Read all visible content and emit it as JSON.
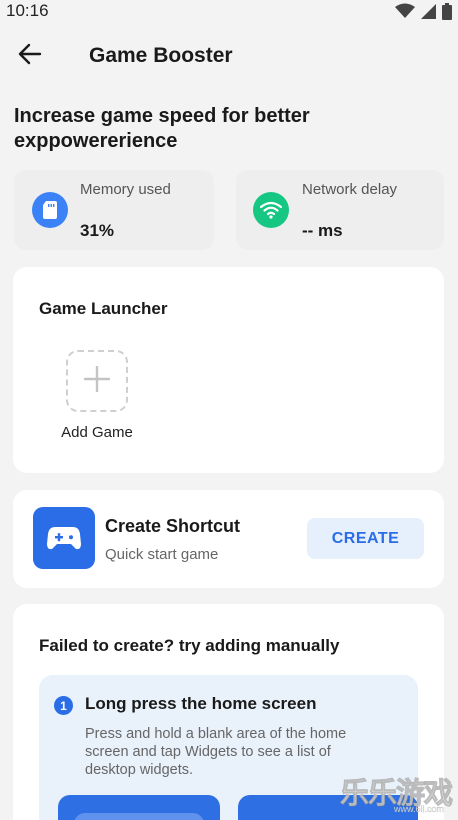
{
  "status_bar": {
    "time": "10:16",
    "icons": [
      "wifi-icon",
      "signal-icon",
      "battery-icon"
    ]
  },
  "app_bar": {
    "title": "Game Booster",
    "back_icon": "arrow-left-icon"
  },
  "headline": "Increase game speed for better exppowererience",
  "stats": {
    "memory": {
      "label": "Memory used",
      "value": "31%",
      "icon": "sd-card-icon",
      "color": "#3b82f6"
    },
    "network": {
      "label": "Network delay",
      "value": "-- ms",
      "icon": "wifi-icon",
      "color": "#16c784"
    }
  },
  "launcher": {
    "title": "Game Launcher",
    "add_label": "Add Game",
    "add_icon": "plus-icon"
  },
  "shortcut": {
    "title": "Create Shortcut",
    "subtitle": "Quick start game",
    "button": "CREATE",
    "icon": "gamepad-icon",
    "accent": "#2a6de6"
  },
  "manual": {
    "title": "Failed to create? try adding manually",
    "step": {
      "number": "1",
      "title": "Long press the home screen",
      "description": "Press and hold a blank area of the home screen and tap Widgets to see a list of desktop widgets."
    }
  },
  "watermark": {
    "text": "乐乐游戏",
    "url": "www.6ll.com"
  }
}
